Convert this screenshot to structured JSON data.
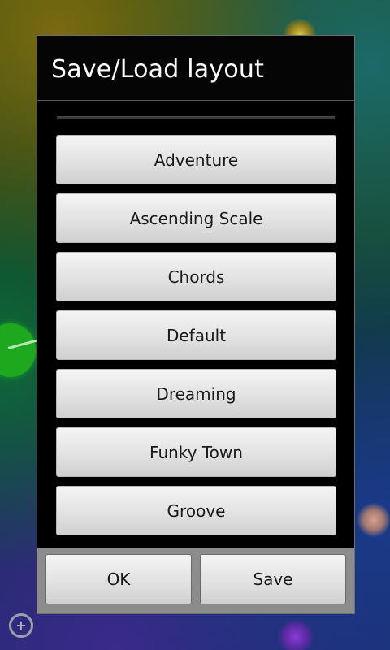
{
  "dialog": {
    "title": "Save/Load layout",
    "layouts": [
      "Adventure",
      "Ascending Scale",
      "Chords",
      "Default",
      "Dreaming",
      "Funky Town",
      "Groove"
    ],
    "ok_label": "OK",
    "save_label": "Save"
  },
  "background": {
    "corner_icon": "add-circle-icon"
  }
}
